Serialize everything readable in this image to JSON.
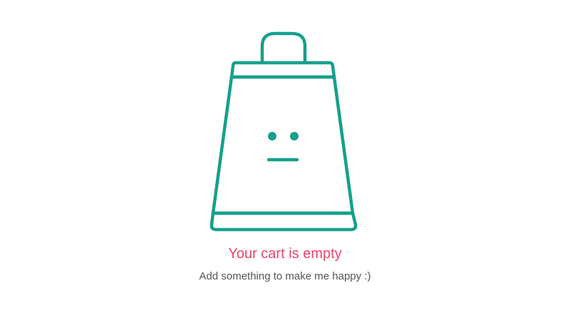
{
  "empty_cart": {
    "illustration_icon": "shopping-bag-neutral-face-icon",
    "title": "Your cart is empty",
    "subtitle": "Add something to make me happy :)"
  },
  "colors": {
    "accent": "#16a08c",
    "title": "#e8436b",
    "subtitle": "#555555",
    "background": "#ffffff"
  }
}
